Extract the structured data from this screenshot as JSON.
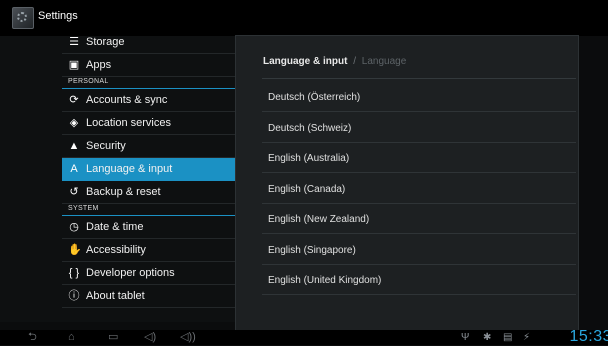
{
  "app": {
    "title": "Settings",
    "icon": "settings-gear-icon"
  },
  "sidebar": {
    "items": [
      {
        "type": "item",
        "label": "Storage",
        "icon": "storage-icon",
        "glyph": "☰"
      },
      {
        "type": "item",
        "label": "Apps",
        "icon": "apps-icon",
        "glyph": "▣"
      },
      {
        "type": "section",
        "label": "PERSONAL"
      },
      {
        "type": "item",
        "label": "Accounts & sync",
        "icon": "sync-icon",
        "glyph": "⟳"
      },
      {
        "type": "item",
        "label": "Location services",
        "icon": "location-icon",
        "glyph": "◈"
      },
      {
        "type": "item",
        "label": "Security",
        "icon": "lock-icon",
        "glyph": "▲"
      },
      {
        "type": "item",
        "label": "Language & input",
        "icon": "language-icon",
        "glyph": "A",
        "selected": true
      },
      {
        "type": "item",
        "label": "Backup & reset",
        "icon": "backup-icon",
        "glyph": "↺"
      },
      {
        "type": "section",
        "label": "SYSTEM"
      },
      {
        "type": "item",
        "label": "Date & time",
        "icon": "clock-icon",
        "glyph": "◷"
      },
      {
        "type": "item",
        "label": "Accessibility",
        "icon": "accessibility-hand-icon",
        "glyph": "✋"
      },
      {
        "type": "item",
        "label": "Developer options",
        "icon": "developer-braces-icon",
        "glyph": "{ }"
      },
      {
        "type": "item",
        "label": "About tablet",
        "icon": "info-icon",
        "glyph": "ⓘ"
      }
    ]
  },
  "content": {
    "breadcrumb_main": "Language & input",
    "breadcrumb_sep": "/",
    "breadcrumb_sub": "Language",
    "languages": [
      "Deutsch (Österreich)",
      "Deutsch (Schweiz)",
      "English (Australia)",
      "English (Canada)",
      "English (New Zealand)",
      "English (Singapore)",
      "English (United Kingdom)"
    ]
  },
  "navbar": {
    "buttons": [
      {
        "name": "back-icon",
        "glyph": "⮌"
      },
      {
        "name": "home-icon",
        "glyph": "⌂"
      },
      {
        "name": "recent-apps-icon",
        "glyph": "▭"
      },
      {
        "name": "volume-down-icon",
        "glyph": "◁)"
      },
      {
        "name": "volume-up-icon",
        "glyph": "◁))"
      }
    ],
    "status_icons": [
      {
        "name": "usb-icon",
        "glyph": "Ψ"
      },
      {
        "name": "android-debug-icon",
        "glyph": "✱"
      },
      {
        "name": "sd-card-icon",
        "glyph": "▤"
      },
      {
        "name": "signal-icon",
        "glyph": "⚡"
      }
    ],
    "clock": "15:33"
  },
  "colors": {
    "accent": "#1b91c4",
    "clock": "#2aa7df",
    "background": "#0b0c0d",
    "panel": "#1d2022"
  }
}
